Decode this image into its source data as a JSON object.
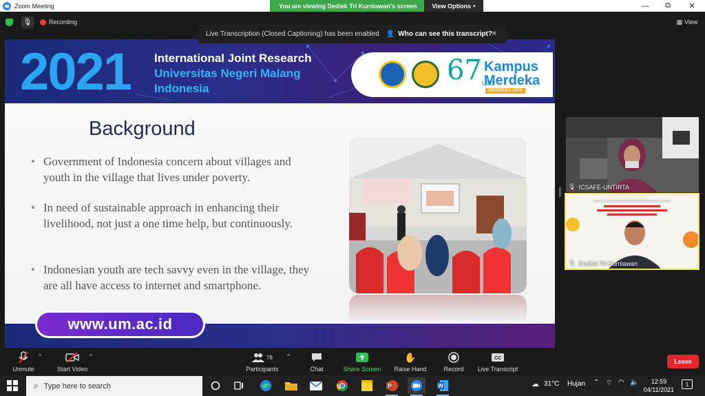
{
  "window": {
    "title": "Zoom Meeting"
  },
  "viewing_banner": {
    "text": "You are viewing Dediek Tri Kurniawan's screen",
    "options_label": "View Options"
  },
  "window_controls": {
    "minimize": "—",
    "restore": "⧉",
    "close": "✕"
  },
  "meeting_top": {
    "recording_label": "Recording",
    "view_label": "View"
  },
  "transcript_banner": {
    "message": "Live Transcription (Closed Captioning) has been enabled",
    "link_label": "Who can see this transcript?",
    "close": "✕"
  },
  "slide": {
    "year": "2021",
    "header_line1": "International Joint Research",
    "header_line2": "Universitas Negeri Malang",
    "header_line3": "Indonesia",
    "logo_67": "67",
    "logo_67_sub": "um",
    "kampus_line1": "Kampus",
    "kampus_line2": "Merdeka",
    "kampus_tag": "INDONESIA JAYA",
    "title": "Background",
    "bullets": [
      "Government of Indonesia concern about villages and youth in the village that lives under poverty.",
      "In need of sustainable approach in enhancing their livelihood, not just a one time help, but continuously.",
      "Indonesian youth are tech savvy even in the village, they are all have access to internet and smartphone."
    ],
    "url": "www.um.ac.id"
  },
  "participants_video": [
    {
      "name": "ICSAFE-UNTIRTA"
    },
    {
      "name": "Dediek Tri Kurniawan"
    }
  ],
  "toolbar": {
    "unmute": "Unmute",
    "start_video": "Start Video",
    "participants": "Participants",
    "participants_count": "78",
    "chat": "Chat",
    "share_screen": "Share Screen",
    "raise_hand": "Raise Hand",
    "record": "Record",
    "live_transcript": "Live Transcript",
    "leave": "Leave"
  },
  "taskbar": {
    "search_placeholder": "Type here to search",
    "temperature": "31°C",
    "weather": "Hujan",
    "time": "12:59",
    "date": "04/11/2021",
    "notification_count": "1"
  },
  "colors": {
    "zoom_green": "#3ca84a",
    "leave_red": "#e0282e",
    "zoom_blue": "#2d8cff",
    "slide_blue": "#2aa5f0"
  }
}
